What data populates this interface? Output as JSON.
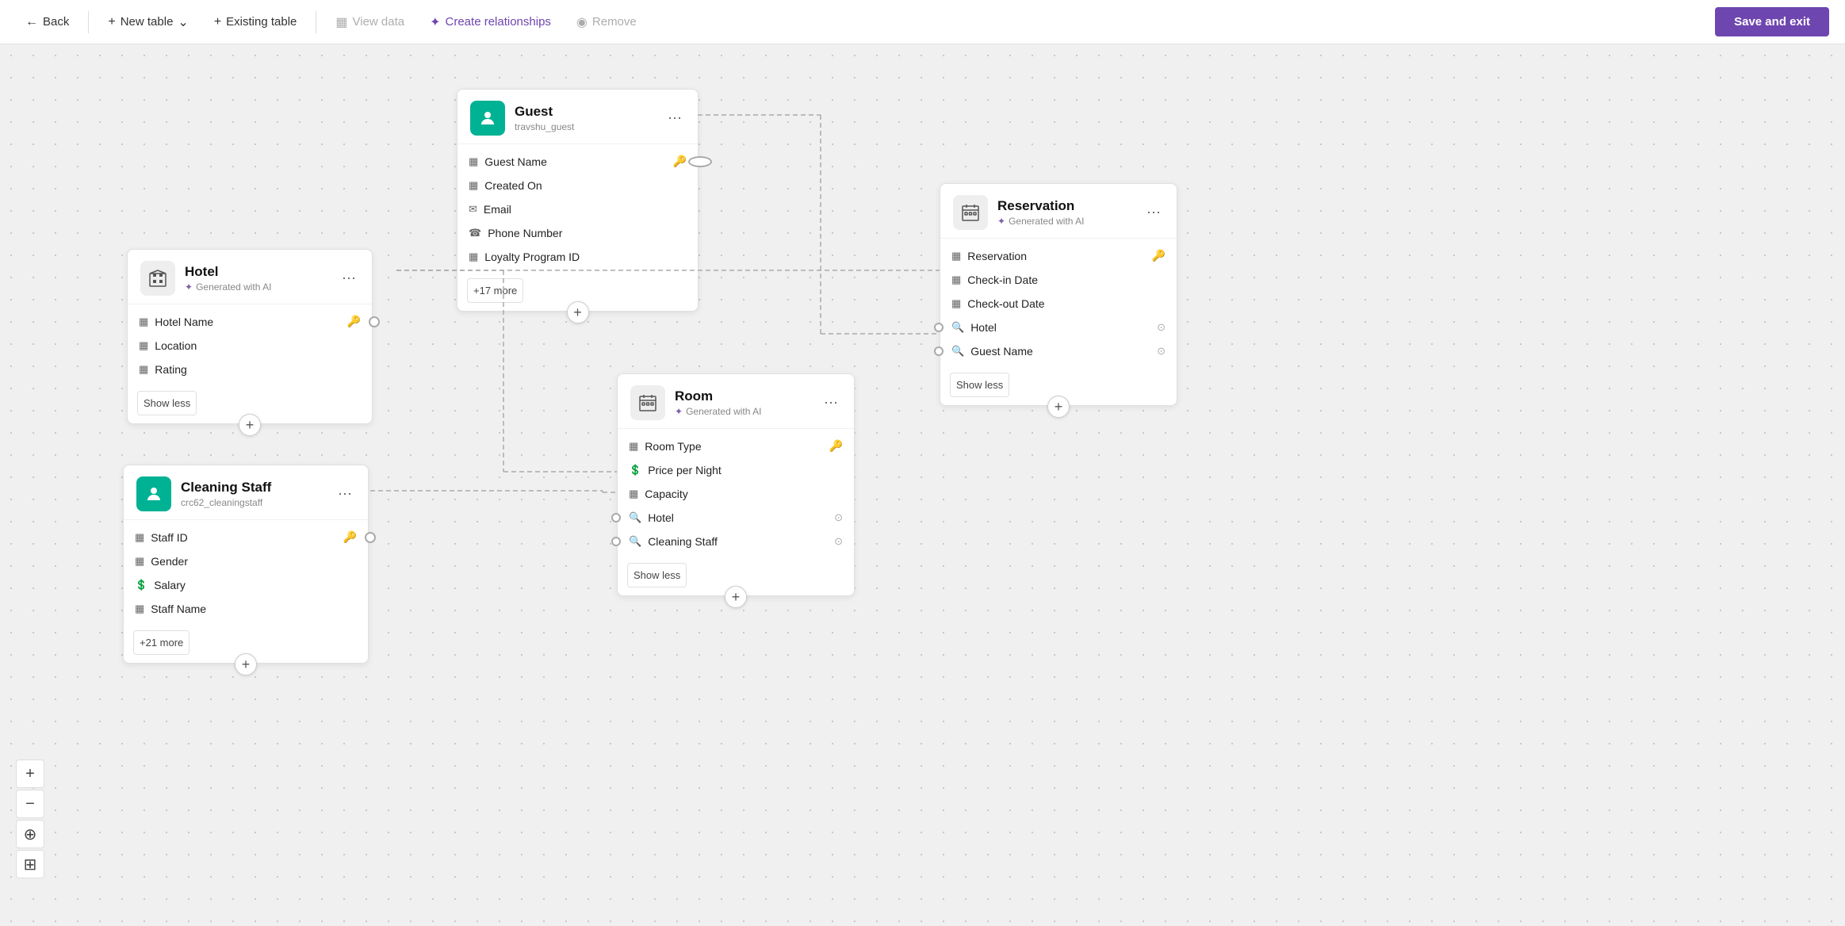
{
  "topnav": {
    "back_label": "Back",
    "new_table_label": "New table",
    "existing_table_label": "Existing table",
    "view_data_label": "View data",
    "create_relationships_label": "Create relationships",
    "remove_label": "Remove",
    "save_exit_label": "Save and exit"
  },
  "zoom_controls": {
    "zoom_in": "+",
    "zoom_out": "−",
    "target_icon": "⊕",
    "map_icon": "⊞"
  },
  "cards": {
    "guest": {
      "title": "Guest",
      "subtitle": "travshu_guest",
      "ai_generated": false,
      "fields": [
        {
          "name": "Guest Name",
          "icon": "▦",
          "key": true
        },
        {
          "name": "Created On",
          "icon": "▦"
        },
        {
          "name": "Email",
          "icon": "✉"
        },
        {
          "name": "Phone Number",
          "icon": "☎"
        },
        {
          "name": "Loyalty Program ID",
          "icon": "▦"
        }
      ],
      "more_label": "+17 more"
    },
    "hotel": {
      "title": "Hotel",
      "subtitle": "Generated with AI",
      "ai_generated": true,
      "fields": [
        {
          "name": "Hotel Name",
          "icon": "▦",
          "key": true
        },
        {
          "name": "Location",
          "icon": "▦"
        },
        {
          "name": "Rating",
          "icon": "▦"
        }
      ],
      "show_less_label": "Show less"
    },
    "reservation": {
      "title": "Reservation",
      "subtitle": "Generated with AI",
      "ai_generated": true,
      "fields": [
        {
          "name": "Reservation",
          "icon": "▦",
          "key": true
        },
        {
          "name": "Check-in Date",
          "icon": "▦"
        },
        {
          "name": "Check-out Date",
          "icon": "▦"
        },
        {
          "name": "Hotel",
          "icon": "🔍",
          "lookup": true
        },
        {
          "name": "Guest Name",
          "icon": "🔍",
          "lookup": true
        }
      ],
      "show_less_label": "Show less"
    },
    "room": {
      "title": "Room",
      "subtitle": "Generated with AI",
      "ai_generated": true,
      "fields": [
        {
          "name": "Room Type",
          "icon": "▦",
          "key": true
        },
        {
          "name": "Price per Night",
          "icon": "💲"
        },
        {
          "name": "Capacity",
          "icon": "▦"
        },
        {
          "name": "Hotel",
          "icon": "🔍",
          "lookup": true
        },
        {
          "name": "Cleaning Staff",
          "icon": "🔍",
          "lookup": true
        }
      ],
      "show_less_label": "Show less"
    },
    "cleaning_staff": {
      "title": "Cleaning Staff",
      "subtitle": "crc62_cleaningstaff",
      "ai_generated": false,
      "fields": [
        {
          "name": "Staff ID",
          "icon": "▦",
          "key": true
        },
        {
          "name": "Gender",
          "icon": "▦"
        },
        {
          "name": "Salary",
          "icon": "💲"
        },
        {
          "name": "Staff Name",
          "icon": "▦"
        }
      ],
      "more_label": "+21 more"
    }
  }
}
